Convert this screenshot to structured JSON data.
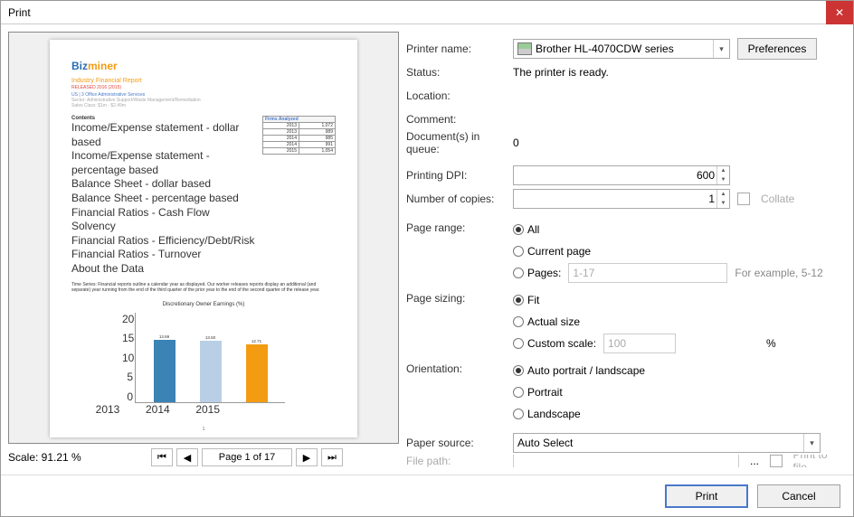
{
  "window": {
    "title": "Print"
  },
  "preview": {
    "logo_part1": "Biz",
    "logo_part2": "miner",
    "report_title": "Industry Financial Report",
    "headline": "RELEASED 2016 (2015)",
    "naics_line": "US | 3 Office Administrative Services",
    "sector_line": "Sector: Administrative Support/Waste Management/Remediation",
    "sales_line": "Sales Class: $1m - $2.49m",
    "section_title": "Contents",
    "table_header": "Firms Analyzed",
    "contents": [
      {
        "label": "Income/Expense statement - dollar based",
        "year": "2013",
        "val": "1,072"
      },
      {
        "label": "Income/Expense statement - percentage based",
        "year": "2013",
        "val": "989"
      },
      {
        "label": "Balance Sheet - dollar based",
        "year": "2014",
        "val": "985"
      },
      {
        "label": "Balance Sheet - percentage based",
        "year": "2014",
        "val": "991"
      },
      {
        "label": "Financial Ratios - Cash Flow Solvency",
        "year": "2015",
        "val": "1,054"
      },
      {
        "label": "Financial Ratios - Efficiency/Debt/Risk",
        "year": "",
        "val": ""
      },
      {
        "label": "Financial Ratios - Turnover",
        "year": "",
        "val": ""
      },
      {
        "label": "About the Data",
        "year": "",
        "val": ""
      }
    ],
    "paragraph": "Time Series: Financial reports outline a calendar year as displayed. Our worker releases reports display an additional (and separate) year running from the end of the third quarter of the prior year to the end of the second quarter of the release year.",
    "chart_caption": "Discretionary Owner Earnings (%)",
    "page_number": "1"
  },
  "chart_data": {
    "type": "bar",
    "title": "Discretionary Owner Earnings (%)",
    "xlabel": "",
    "ylabel": "",
    "ylim": [
      0,
      20
    ],
    "yticks": [
      0,
      5,
      10,
      15,
      20
    ],
    "categories": [
      "2013",
      "2014",
      "2015"
    ],
    "values": [
      13.69,
      13.5,
      12.71
    ],
    "colors": [
      "#3b82b5",
      "#b8cfe6",
      "#f39c12"
    ]
  },
  "scale": {
    "label": "Scale: 91.21 %"
  },
  "pager": {
    "first": "⏮",
    "prev": "◀",
    "label": "Page 1 of 17",
    "next": "▶",
    "last": "⏭"
  },
  "form": {
    "printer_name_label": "Printer name:",
    "printer_name_value": "Brother HL-4070CDW series",
    "preferences_label": "Preferences",
    "status_label": "Status:",
    "status_value": "The printer is ready.",
    "location_label": "Location:",
    "location_value": "",
    "comment_label": "Comment:",
    "comment_value": "",
    "queue_label": "Document(s) in queue:",
    "queue_value": "0",
    "dpi_label": "Printing DPI:",
    "dpi_value": "600",
    "copies_label": "Number of copies:",
    "copies_value": "1",
    "collate_label": "Collate",
    "range_label": "Page range:",
    "range_all": "All",
    "range_current": "Current page",
    "range_pages": "Pages:",
    "range_pages_placeholder": "1-17",
    "range_hint": "For example, 5-12",
    "sizing_label": "Page sizing:",
    "sizing_fit": "Fit",
    "sizing_actual": "Actual size",
    "sizing_custom": "Custom scale:",
    "sizing_custom_value": "100",
    "sizing_custom_suffix": "%",
    "orientation_label": "Orientation:",
    "orientation_auto": "Auto portrait / landscape",
    "orientation_portrait": "Portrait",
    "orientation_landscape": "Landscape",
    "paper_source_label": "Paper source:",
    "paper_source_value": "Auto Select",
    "file_path_label": "File path:",
    "print_to_file_label": "Print to file"
  },
  "footer": {
    "print": "Print",
    "cancel": "Cancel"
  }
}
